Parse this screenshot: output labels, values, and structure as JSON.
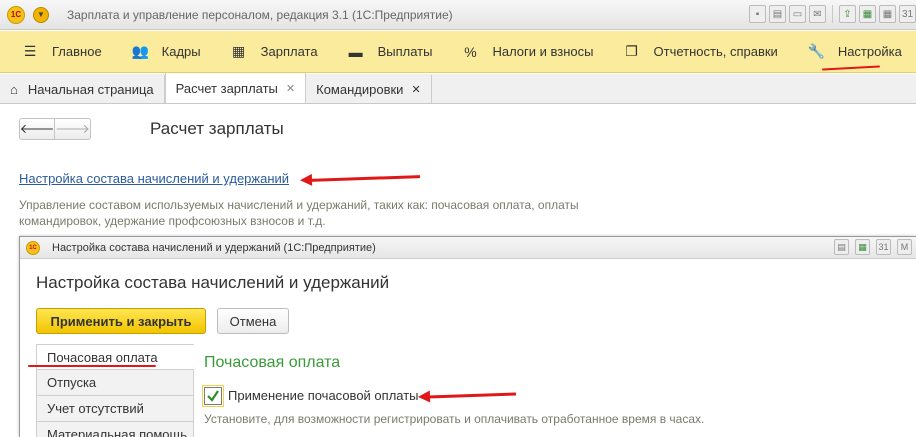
{
  "app": {
    "logo_text": "1С",
    "title": "Зарплата и управление персоналом, редакция 3.1  (1С:Предприятие)"
  },
  "sections": [
    {
      "icon": "hamburger-icon",
      "label": "Главное"
    },
    {
      "icon": "people-icon",
      "label": "Кадры"
    },
    {
      "icon": "calculator-icon",
      "label": "Зарплата"
    },
    {
      "icon": "wallet-icon",
      "label": "Выплаты"
    },
    {
      "icon": "percent-icon",
      "label": "Налоги и взносы"
    },
    {
      "icon": "reports-icon",
      "label": "Отчетность, справки"
    },
    {
      "icon": "wrench-icon",
      "label": "Настройка"
    }
  ],
  "tabs": [
    {
      "label": "Начальная страница"
    },
    {
      "label": "Расчет зарплаты"
    },
    {
      "label": "Командировки"
    }
  ],
  "page": {
    "title": "Расчет зарплаты",
    "link": "Настройка состава начислений и удержаний",
    "description": "Управление составом используемых начислений и удержаний, таких как: почасовая оплата, оплаты командировок, удержание профсоюзных взносов и т.д."
  },
  "dialog": {
    "logo_text": "1С",
    "window_title": "Настройка состава начислений и удержаний  (1С:Предприятие)",
    "heading": "Настройка состава начислений и удержаний",
    "apply_button": "Применить и закрыть",
    "cancel_button": "Отмена",
    "side_items": [
      "Почасовая оплата",
      "Отпуска",
      "Учет отсутствий",
      "Материальная помощь"
    ],
    "group_title": "Почасовая оплата",
    "checkbox_label": "Применение почасовой оплаты",
    "checkbox_checked": true,
    "checkbox_desc": "Установите, для возможности регистрировать и оплачивать отработанное время в часах."
  },
  "colors": {
    "sections_bg": "#fbec9d",
    "accent_yellow": "#f1c400",
    "link": "#2a5b9f",
    "group_title": "#3a9a3a",
    "annotation_red": "#e01818"
  }
}
